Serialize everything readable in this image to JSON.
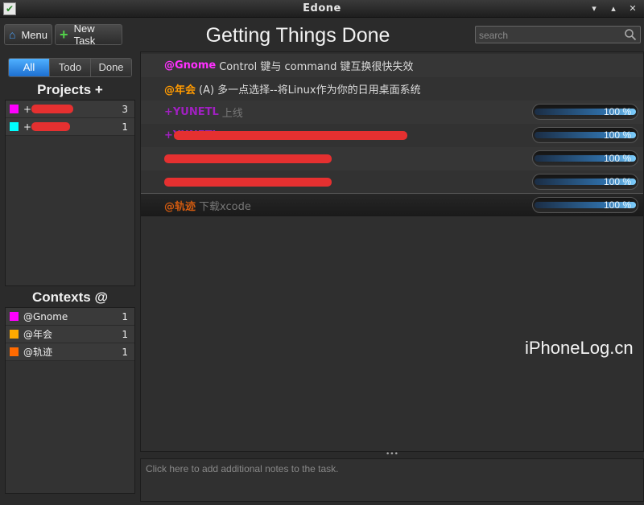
{
  "window": {
    "title": "Edone"
  },
  "toolbar": {
    "menu_label": "Menu",
    "new_task_label": "New Task"
  },
  "app_title": "Getting Things Done",
  "search": {
    "placeholder": "search"
  },
  "filters": {
    "tabs": [
      "All",
      "Todo",
      "Done"
    ],
    "selected": "All"
  },
  "projects": {
    "heading": "Projects +",
    "items": [
      {
        "label": "+",
        "color": "#ff00ff",
        "count": "3"
      },
      {
        "label": "+",
        "color": "#00ffff",
        "count": "1"
      }
    ]
  },
  "contexts": {
    "heading": "Contexts @",
    "items": [
      {
        "label": "@Gnome",
        "color": "#ff00ff",
        "count": "1"
      },
      {
        "label": "@年会",
        "color": "#ffaa00",
        "count": "1"
      },
      {
        "label": "@轨迹",
        "color": "#ff6a00",
        "count": "1"
      }
    ]
  },
  "tasks": [
    {
      "tag": "@Gnome",
      "tag_color": "#ff00ff",
      "text": "Control 键与 command 键互换很快失效",
      "done": false
    },
    {
      "tag": "@年会",
      "tag_color": "#ff9a00",
      "text": "(A) 多一点选择--将Linux作为你的日用桌面系统",
      "done": false
    },
    {
      "tag": "+YUNETL",
      "tag_color": "#a020c0",
      "text": "上线",
      "done": true,
      "progress": "100 %"
    },
    {
      "tag": "+YUNETL",
      "tag_color": "#a020c0",
      "text": "",
      "done": true,
      "progress": "100 %"
    },
    {
      "tag": "",
      "tag_color": "#a020c0",
      "text": "",
      "done": true,
      "progress": "100 %"
    },
    {
      "tag": "",
      "tag_color": "#20a0a0",
      "text": "",
      "done": true,
      "progress": "100 %"
    },
    {
      "tag": "@轨迹",
      "tag_color": "#c05a10",
      "text": "下载xcode",
      "done": true,
      "progress": "100 %"
    }
  ],
  "notes": {
    "placeholder": "Click here to add additional notes to the task."
  },
  "watermark": "iPhoneLog.cn",
  "colors": {
    "accent": "#2a8af0",
    "background": "#2b2b2b",
    "progress": "#6fc8ff"
  }
}
